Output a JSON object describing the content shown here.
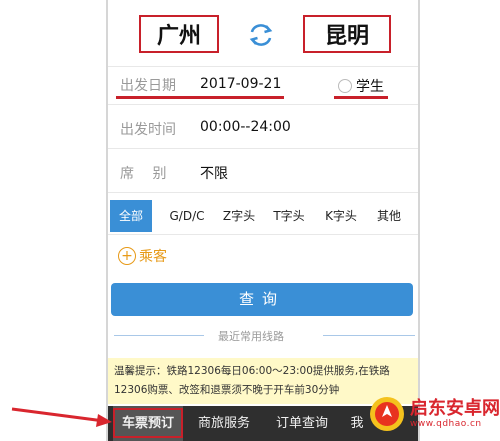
{
  "stations": {
    "from": "广州",
    "to": "昆明"
  },
  "rows": {
    "date": {
      "label": "出发日期",
      "value": "2017-09-21"
    },
    "time": {
      "label": "出发时间",
      "value": "00:00--24:00"
    },
    "seat": {
      "label": "席　 别",
      "value": "不限"
    }
  },
  "student_label": "学生",
  "filters": [
    "全部",
    "G/D/C",
    "Z字头",
    "T字头",
    "K字头",
    "其他"
  ],
  "passenger_label": "乘客",
  "query_button": "查询",
  "recent_label": "最近常用线路",
  "notice": {
    "line1": "温馨提示：铁路12306每日06:00～23:00提供服务,在铁路",
    "line2": "12306购票、改签和退票须不晚于开车前30分钟"
  },
  "bottom_nav": [
    "车票预订",
    "商旅服务",
    "订单查询",
    "我"
  ],
  "watermark": {
    "name": "启东安卓网",
    "url": "www.qdhao.cn"
  },
  "colors": {
    "accent": "#3a8fd6",
    "highlight_red": "#c8202a",
    "passenger_orange": "#e79a18",
    "nav_bg": "#2f2f2f"
  }
}
